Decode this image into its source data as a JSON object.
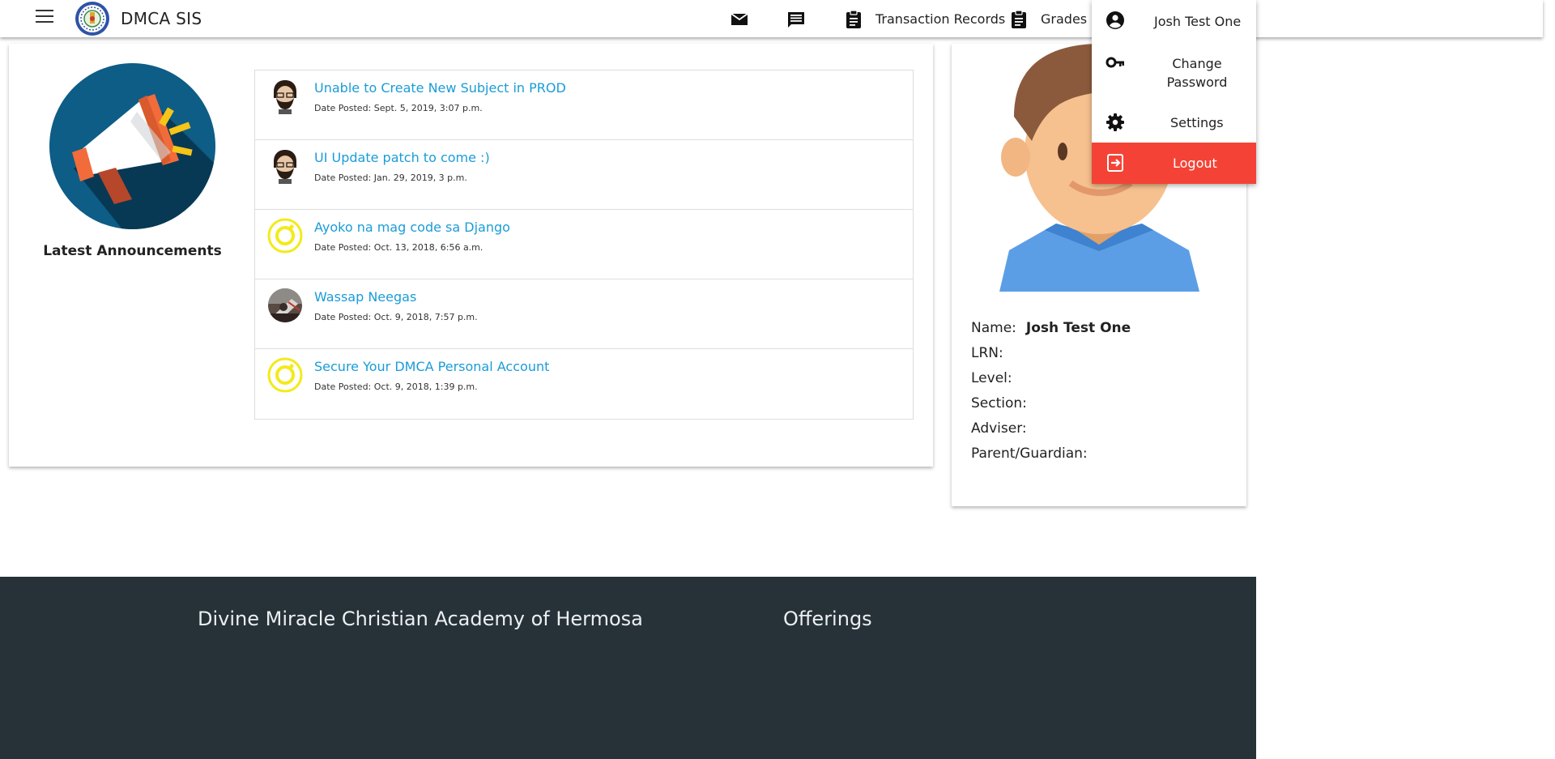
{
  "app": {
    "brand": "DMCA SIS"
  },
  "nav": {
    "mail_icon": "mail-icon",
    "messages_icon": "message-icon",
    "transaction_label": "Transaction Records",
    "grades_label": "Grades"
  },
  "user_menu": {
    "name": "Josh Test One",
    "change_password": "Change Password",
    "settings": "Settings",
    "logout": "Logout",
    "logout_color": "#f44336"
  },
  "announcements": {
    "heading": "Latest Announcements",
    "items": [
      {
        "title": "Unable to Create New Subject in PROD",
        "date": "Date Posted: Sept. 5, 2019, 3:07 p.m.",
        "avatar": "bearded-man-avatar"
      },
      {
        "title": "UI Update patch to come :)",
        "date": "Date Posted: Jan. 29, 2019, 3 p.m.",
        "avatar": "bearded-man-avatar"
      },
      {
        "title": "Ayoko na mag code sa Django",
        "date": "Date Posted: Oct. 13, 2018, 6:56 a.m.",
        "avatar": "yellow-ring-avatar"
      },
      {
        "title": "Wassap Neegas",
        "date": "Date Posted: Oct. 9, 2018, 7:57 p.m.",
        "avatar": "photo-avatar"
      },
      {
        "title": "Secure Your DMCA Personal Account",
        "date": "Date Posted: Oct. 9, 2018, 1:39 p.m.",
        "avatar": "yellow-ring-avatar"
      }
    ]
  },
  "profile": {
    "name_label": "Name:",
    "name_value": "Josh Test One",
    "lrn_label": "LRN:",
    "level_label": "Level:",
    "section_label": "Section:",
    "adviser_label": "Adviser:",
    "parent_label": "Parent/Guardian:"
  },
  "footer": {
    "school": "Divine Miracle Christian Academy of Hermosa",
    "offerings": "Offerings"
  },
  "colors": {
    "link": "#1a9cd8",
    "footer_bg": "#263238",
    "megaphone_bg": "#0d5d86"
  }
}
